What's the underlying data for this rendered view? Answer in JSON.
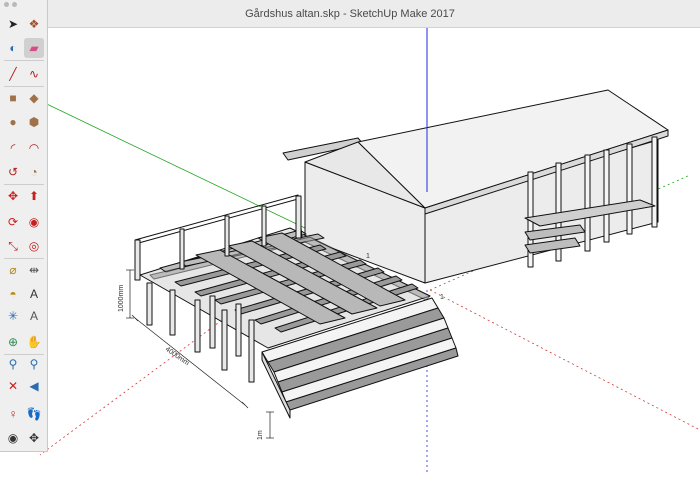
{
  "window": {
    "title": "Gårdshus altan.skp - SketchUp Make 2017"
  },
  "toolbar": {
    "tools": [
      {
        "name": "select-tool-icon",
        "glyph": "➤",
        "color": "#222222"
      },
      {
        "name": "make-component-icon",
        "glyph": "❖",
        "color": "#a0522d"
      },
      {
        "name": "paint-bucket-icon",
        "glyph": "◐",
        "color": "#2b6cb0"
      },
      {
        "name": "eraser-icon",
        "glyph": "▰",
        "color": "#d64b8a"
      },
      {
        "name": "line-tool-icon",
        "glyph": "╱",
        "color": "#b02020"
      },
      {
        "name": "freehand-tool-icon",
        "glyph": "∿",
        "color": "#b02020"
      },
      {
        "name": "rectangle-tool-icon",
        "glyph": "■",
        "color": "#a0724a"
      },
      {
        "name": "rotated-rectangle-icon",
        "glyph": "◆",
        "color": "#a0724a"
      },
      {
        "name": "circle-tool-icon",
        "glyph": "●",
        "color": "#a0724a"
      },
      {
        "name": "polygon-tool-icon",
        "glyph": "⬢",
        "color": "#a0724a"
      },
      {
        "name": "arc-tool-icon",
        "glyph": "◜",
        "color": "#b02020"
      },
      {
        "name": "two-point-arc-icon",
        "glyph": "◠",
        "color": "#b02020"
      },
      {
        "name": "three-point-arc-icon",
        "glyph": "↺",
        "color": "#b02020"
      },
      {
        "name": "pie-tool-icon",
        "glyph": "◔",
        "color": "#a0724a"
      },
      {
        "name": "move-tool-icon",
        "glyph": "✥",
        "color": "#c81e1e"
      },
      {
        "name": "push-pull-icon",
        "glyph": "⬆",
        "color": "#c81e1e"
      },
      {
        "name": "rotate-tool-icon",
        "glyph": "⟳",
        "color": "#c81e1e"
      },
      {
        "name": "follow-me-icon",
        "glyph": "◉",
        "color": "#c81e1e"
      },
      {
        "name": "scale-tool-icon",
        "glyph": "⤡",
        "color": "#c81e1e"
      },
      {
        "name": "offset-tool-icon",
        "glyph": "◎",
        "color": "#c81e1e"
      },
      {
        "name": "tape-measure-icon",
        "glyph": "⌀",
        "color": "#b8860b"
      },
      {
        "name": "dimension-tool-icon",
        "glyph": "⇹",
        "color": "#555555"
      },
      {
        "name": "protractor-icon",
        "glyph": "◓",
        "color": "#b8860b"
      },
      {
        "name": "text-tool-icon",
        "glyph": "A",
        "color": "#333333"
      },
      {
        "name": "axes-tool-icon",
        "glyph": "✳",
        "color": "#2b6cb0"
      },
      {
        "name": "3d-text-icon",
        "glyph": "A",
        "color": "#555555"
      },
      {
        "name": "orbit-tool-icon",
        "glyph": "⊕",
        "color": "#2e8b57"
      },
      {
        "name": "pan-tool-icon",
        "glyph": "✋",
        "color": "#b8860b"
      },
      {
        "name": "zoom-tool-icon",
        "glyph": "⚲",
        "color": "#2b6cb0"
      },
      {
        "name": "zoom-window-icon",
        "glyph": "⚲",
        "color": "#2b6cb0"
      },
      {
        "name": "zoom-extents-icon",
        "glyph": "✕",
        "color": "#c81e1e"
      },
      {
        "name": "previous-view-icon",
        "glyph": "◀",
        "color": "#2b6cb0"
      },
      {
        "name": "position-camera-icon",
        "glyph": "♀",
        "color": "#c81e1e"
      },
      {
        "name": "walk-tool-icon",
        "glyph": "👣",
        "color": "#333333"
      },
      {
        "name": "look-around-icon",
        "glyph": "◉",
        "color": "#333333"
      },
      {
        "name": "section-plane-icon",
        "glyph": "✥",
        "color": "#333333"
      }
    ]
  },
  "dimensions": {
    "height": "1000mm",
    "length": "4000mm",
    "step": "1m",
    "height_tag": "1",
    "side_tag": "1"
  },
  "colors": {
    "red_axis": "#d23a3a",
    "green_axis": "#22a422",
    "blue_axis": "#1f2ae0",
    "face": "#ececec",
    "edge": "#111111",
    "tread": "#9a9a9a"
  }
}
